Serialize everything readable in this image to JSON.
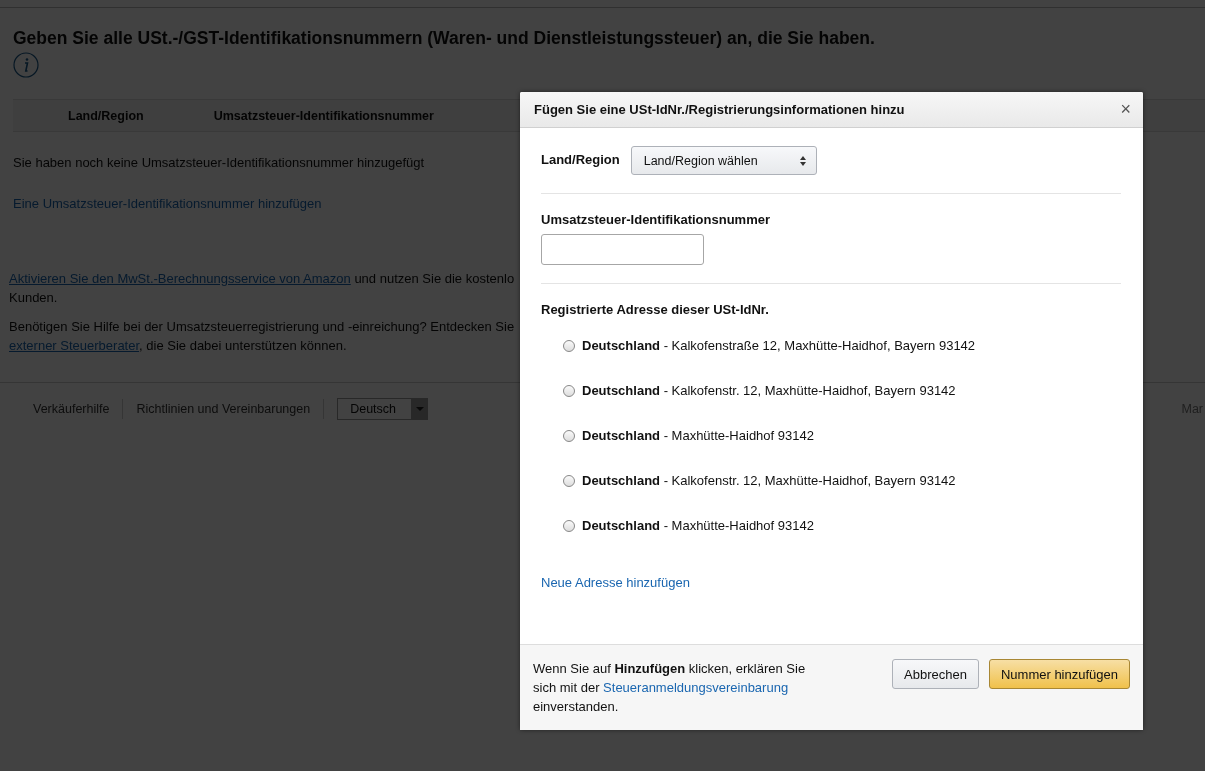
{
  "page": {
    "heading": "Geben Sie alle USt.-/GST-Identifikationsnummern (Waren- und Dienstleistungssteuer) an, die Sie haben.",
    "table": {
      "columns": [
        "Land/Region",
        "Umsatzsteuer-Identifikationsnummer"
      ]
    },
    "empty_message": "Sie haben noch keine Umsatzsteuer-Identifikationsnummer hinzugefügt",
    "add_link": "Eine Umsatzsteuer-Identifikationsnummer hinzufügen",
    "paragraphs": [
      [
        [
          {
            "text": "Aktivieren Sie den MwSt.-Berechnungsservice von Amazon",
            "link": true
          },
          {
            "text": " und nutzen Sie die kostenlo",
            "link": false
          }
        ],
        [
          {
            "text": "Kunden.",
            "link": false
          }
        ]
      ],
      [
        [
          {
            "text": "Benötigen Sie Hilfe bei der Umsatzsteuerregistrierung und -einreichung? Entdecken Sie",
            "link": false
          }
        ],
        [
          {
            "text": "externer Steuerberater",
            "link": true
          },
          {
            "text": ", die Sie dabei unterstützen können.",
            "link": false
          }
        ]
      ]
    ]
  },
  "footer": {
    "links": [
      "Verkäuferhilfe",
      "Richtlinien und Vereinbarungen"
    ],
    "language": "Deutsch",
    "right_text": "Mar"
  },
  "dialog": {
    "title": "Fügen Sie eine USt-IdNr./Registrierungsinformationen hinzu",
    "close": "×",
    "country": {
      "label": "Land/Region",
      "value": "Land/Region wählen"
    },
    "vat": {
      "label": "Umsatzsteuer-Identifikationsnummer"
    },
    "address": {
      "label": "Registrierte Adresse dieser USt-IdNr.",
      "options": [
        {
          "country": "Deutschland",
          "address": "- Kalkofenstraße 12, Maxhütte-Haidhof, Bayern 93142",
          "selected": false
        },
        {
          "country": "Deutschland",
          "address": "- Kalkofenstr. 12, Maxhütte-Haidhof, Bayern 93142",
          "selected": false
        },
        {
          "country": "Deutschland",
          "address": "- Maxhütte-Haidhof 93142",
          "selected": false
        },
        {
          "country": "Deutschland",
          "address": "- Kalkofenstr. 12, Maxhütte-Haidhof, Bayern 93142",
          "selected": false
        },
        {
          "country": "Deutschland",
          "address": "- Maxhütte-Haidhof 93142",
          "selected": false
        }
      ]
    },
    "new_address_link": "Neue Adresse hinzufügen",
    "note": {
      "before": "Wenn Sie auf **Hinzufügen** klicken, erklären Sie sich mit der",
      "link": "Steueranmeldungsvereinbarung",
      "after": "einverstanden."
    },
    "buttons": {
      "cancel": "Abbrechen",
      "submit": "Nummer hinzufügen"
    }
  }
}
